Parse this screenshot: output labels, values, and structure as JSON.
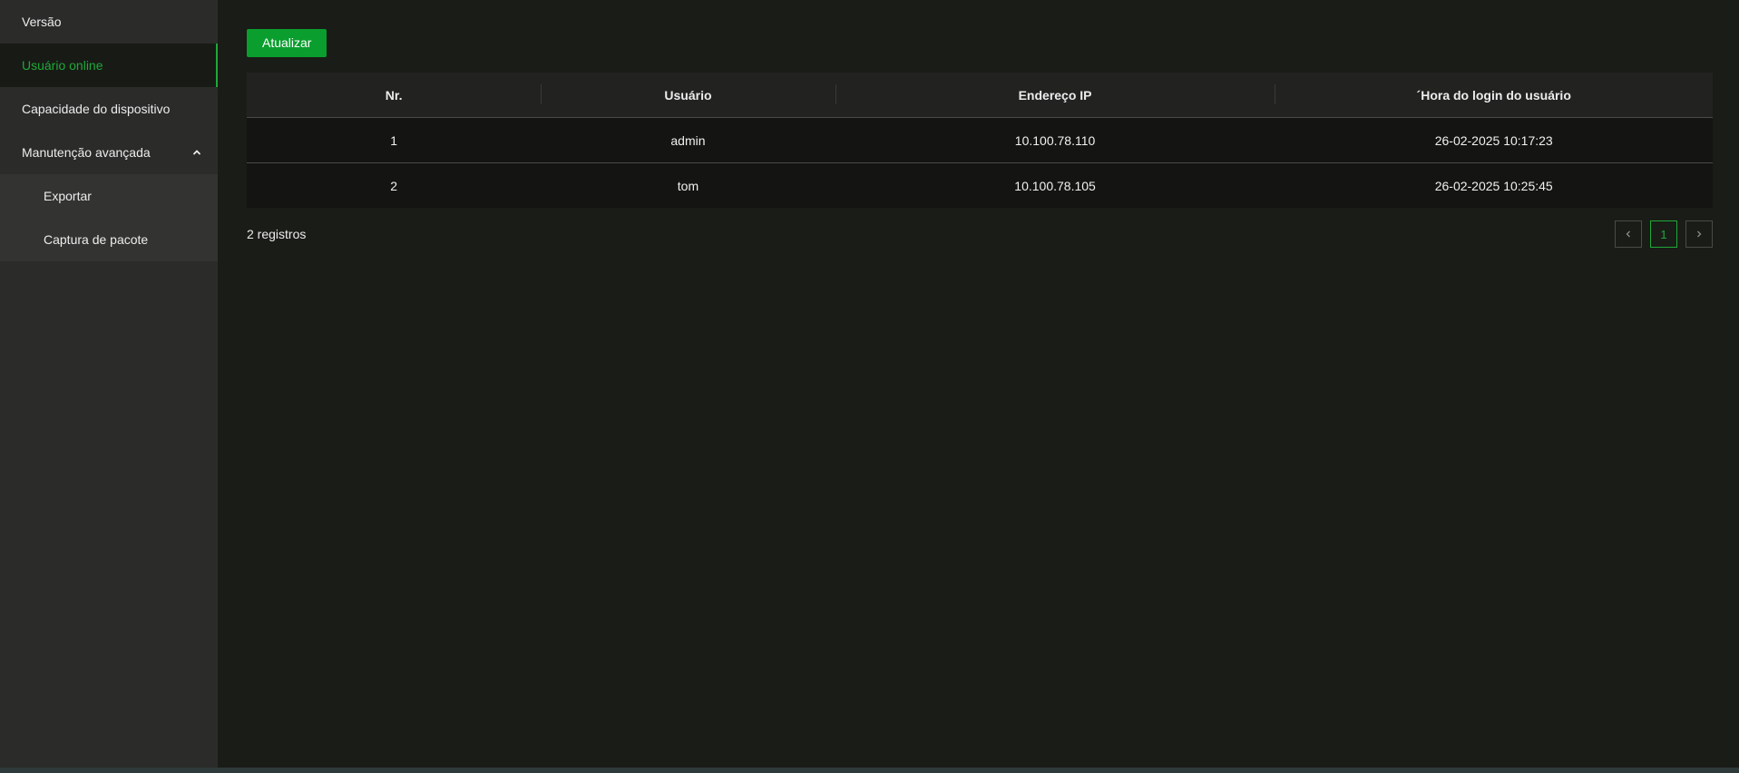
{
  "sidebar": {
    "items": [
      {
        "label": "Versão"
      },
      {
        "label": "Usuário online"
      },
      {
        "label": "Capacidade do dispositivo"
      },
      {
        "label": "Manutenção avançada",
        "icon": "chevron-up-icon"
      }
    ],
    "sub_items": [
      {
        "label": "Exportar"
      },
      {
        "label": "Captura de pacote"
      }
    ]
  },
  "toolbar": {
    "refresh_label": "Atualizar"
  },
  "table": {
    "headers": [
      "Nr.",
      "Usuário",
      "Endereço IP",
      "´Hora do login do usuário"
    ],
    "rows": [
      [
        "1",
        "admin",
        "10.100.78.110",
        "26-02-2025 10:17:23"
      ],
      [
        "2",
        "tom",
        "10.100.78.105",
        "26-02-2025 10:25:45"
      ]
    ]
  },
  "footer": {
    "records_text": "2 registros"
  },
  "pagination": {
    "current_page": "1"
  },
  "colors": {
    "accent": "#1fa838",
    "button": "#0a9e2e",
    "sidebar_bg": "#2b2c2a",
    "main_bg": "#1a1c17"
  }
}
